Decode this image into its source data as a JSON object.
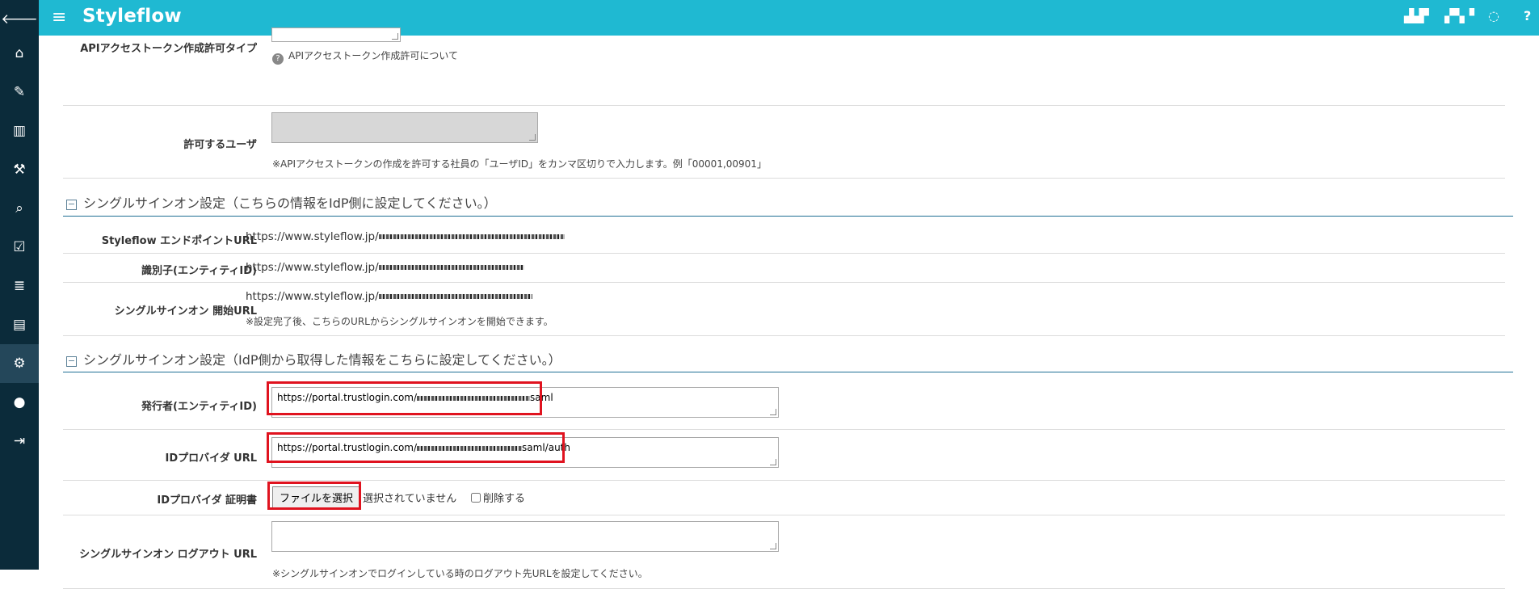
{
  "app": {
    "brand": "Styleflow"
  },
  "sidebar": {
    "items": [
      {
        "icon": "back-arrow-icon",
        "glyph": "🡐"
      },
      {
        "icon": "home-icon",
        "glyph": "⌂"
      },
      {
        "icon": "edit-icon",
        "glyph": "✎"
      },
      {
        "icon": "book-icon",
        "glyph": "▥"
      },
      {
        "icon": "gavel-icon",
        "glyph": "⚒"
      },
      {
        "icon": "search-icon",
        "glyph": "⌕"
      },
      {
        "icon": "checkbox-icon",
        "glyph": "☑"
      },
      {
        "icon": "server-icon",
        "glyph": "≣"
      },
      {
        "icon": "id-card-icon",
        "glyph": "▤"
      },
      {
        "icon": "gears-icon",
        "glyph": "⚙"
      },
      {
        "icon": "user-icon",
        "glyph": "●"
      },
      {
        "icon": "logout-icon",
        "glyph": "⇥"
      }
    ]
  },
  "header": {
    "menu_glyph": "≡",
    "icons": [
      {
        "icon": "flag-icon",
        "glyph": "▟▟▘"
      },
      {
        "icon": "bell-icon",
        "glyph": "▞▚▝"
      },
      {
        "icon": "chat-icon",
        "glyph": "◌"
      },
      {
        "icon": "help-icon",
        "glyph": "?"
      }
    ]
  },
  "api_section": {
    "type_label": "APIアクセストークン作成許可タイプ",
    "type_help": "APIアクセストークン作成許可について",
    "help_glyph": "?",
    "users_label": "許可するユーザ",
    "users_value": "",
    "users_note": "※APIアクセストークンの作成を許可する社員の「ユーザID」をカンマ区切りで入力します。例「00001,00901」"
  },
  "sso_out": {
    "toggle": "−",
    "title": "シングルサインオン設定（こちらの情報をIdP側に設定してください。）",
    "endpoint_label": "Styleflow エンドポイントURL",
    "endpoint_value": "https://www.styleflow.jp/",
    "entity_label": "識別子(エンティティID)",
    "entity_value": "https://www.styleflow.jp/",
    "start_label": "シングルサインオン 開始URL",
    "start_value": "https://www.styleflow.jp/",
    "start_note": "※設定完了後、こちらのURLからシングルサインオンを開始できます。"
  },
  "sso_in": {
    "toggle": "−",
    "title": "シングルサインオン設定（IdP側から取得した情報をこちらに設定してください。）",
    "issuer_label": "発行者(エンティティID)",
    "issuer_value_prefix": "https://portal.trustlogin.com/",
    "issuer_value_suffix": "saml",
    "idp_url_label": "IDプロバイダ URL",
    "idp_url_prefix": "https://portal.trustlogin.com/",
    "idp_url_suffix": "saml/auth",
    "cert_label": "IDプロバイダ 証明書",
    "file_button": "ファイルを選択",
    "file_status": "選択されていません",
    "delete_label": "削除する",
    "logout_label": "シングルサインオン ログアウト URL",
    "logout_value": "",
    "logout_note": "※シングルサインオンでログインしている時のログアウト先URLを設定してください。"
  },
  "colors": {
    "header": "#1fb9d2",
    "sidebar": "#0b2b3a",
    "highlight": "#e0131f",
    "section_line": "#1f6f94"
  }
}
